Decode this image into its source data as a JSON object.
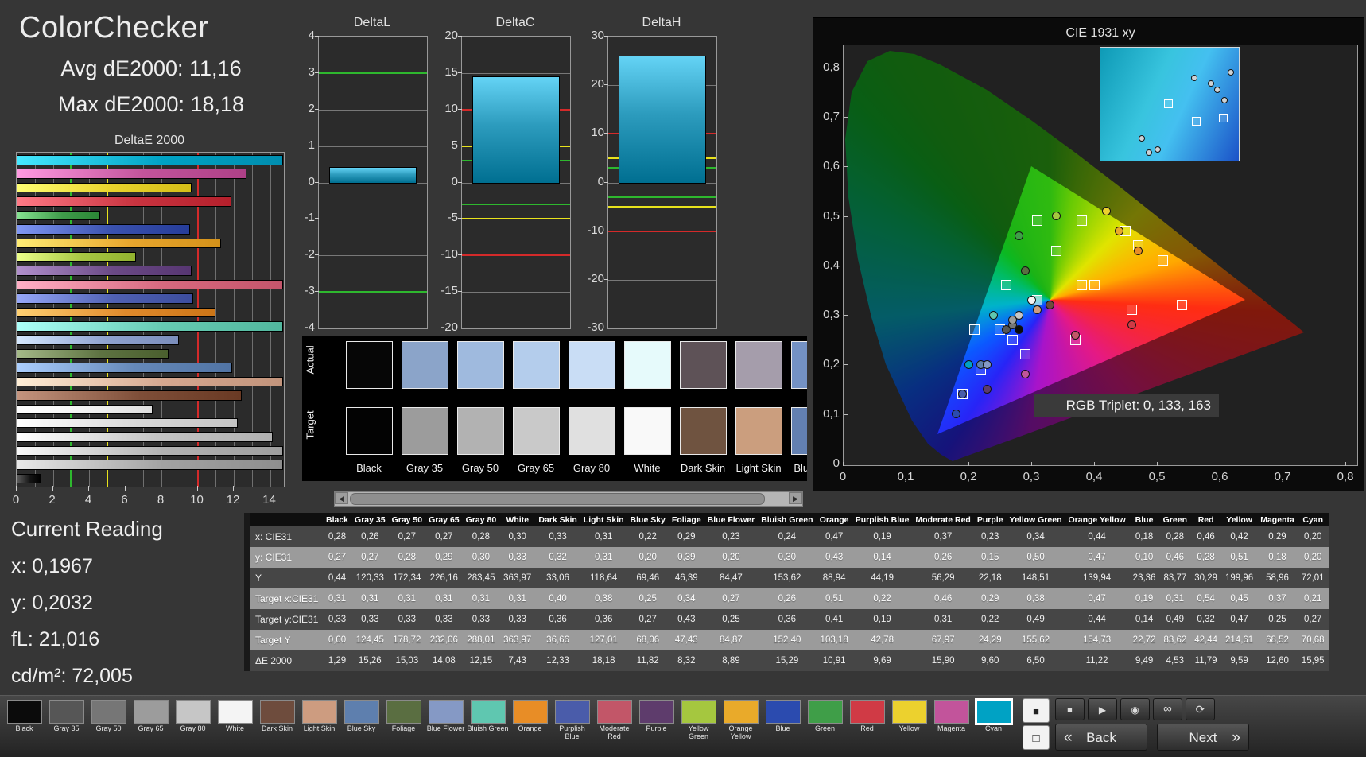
{
  "header": {
    "title": "ColorChecker",
    "avg": "Avg dE2000: 11,16",
    "max": "Max dE2000: 18,18"
  },
  "current_reading": {
    "title": "Current Reading",
    "lines": [
      "x: 0,1967",
      "y: 0,2032",
      "fL: 21,016",
      "cd/m²: 72,005"
    ]
  },
  "chart_data": [
    {
      "type": "bar",
      "title": "DeltaE 2000",
      "orientation": "horizontal",
      "xlim": [
        0,
        14.68
      ],
      "x_ticks": [
        0,
        2,
        4,
        6,
        8,
        10,
        12,
        14
      ],
      "reference_lines": [
        {
          "value": 3,
          "color": "#2eb82e"
        },
        {
          "value": 5,
          "color": "#e8e21c"
        },
        {
          "value": 10,
          "color": "#d42a2a"
        }
      ],
      "categories": [
        "Cyan",
        "Magenta",
        "Yellow",
        "Red",
        "Green",
        "Blue",
        "Orange Yellow",
        "Yellow Green",
        "Purple",
        "Moderate Red",
        "Purplish Blue",
        "Orange",
        "Bluish Green",
        "Blue Flower",
        "Foliage",
        "Blue Sky",
        "Light Skin",
        "Dark Skin",
        "White",
        "Gray 80",
        "Gray 65",
        "Gray 50",
        "Gray 35",
        "Black"
      ],
      "values": [
        15.95,
        12.6,
        9.59,
        11.79,
        4.53,
        9.49,
        11.22,
        6.5,
        9.6,
        15.9,
        9.69,
        10.91,
        15.29,
        8.89,
        8.32,
        11.82,
        18.18,
        12.33,
        7.43,
        12.15,
        14.08,
        15.03,
        15.26,
        1.29
      ],
      "colors": [
        "#00a2c4",
        "#c2549b",
        "#e8d22c",
        "#c93440",
        "#3f9b4a",
        "#3a51ae",
        "#e8a62e",
        "#a6c643",
        "#6b4a86",
        "#d8697f",
        "#5061b2",
        "#e08a2c",
        "#66cbb2",
        "#8fa2cf",
        "#5e7342",
        "#6588b8",
        "#d6a890",
        "#7e4e38",
        "#f2f2f2",
        "#d8d8d8",
        "#c4c4c4",
        "#b2b2b2",
        "#a2a2a2",
        "#141414"
      ]
    },
    {
      "type": "bar",
      "title": "DeltaL",
      "ylim": [
        -4,
        4
      ],
      "y_ticks": [
        4,
        3,
        2,
        1,
        0,
        -1,
        -2,
        -3,
        -4
      ],
      "values": [
        0.42
      ],
      "bar_color": "#2d9cbe",
      "reference_lines": [
        {
          "value": 3,
          "color": "#2eb82e"
        },
        {
          "value": -3,
          "color": "#2eb82e"
        }
      ]
    },
    {
      "type": "bar",
      "title": "DeltaC",
      "ylim": [
        -20,
        20
      ],
      "y_ticks": [
        20,
        15,
        10,
        5,
        0,
        -5,
        -10,
        -15,
        -20
      ],
      "values": [
        14.6
      ],
      "bar_color": "#2d9cbe",
      "reference_lines": [
        {
          "value": 10,
          "color": "#d42a2a"
        },
        {
          "value": 5,
          "color": "#e8e21c"
        },
        {
          "value": 3,
          "color": "#2eb82e"
        },
        {
          "value": -3,
          "color": "#2eb82e"
        },
        {
          "value": -5,
          "color": "#e8e21c"
        },
        {
          "value": -10,
          "color": "#d42a2a"
        }
      ]
    },
    {
      "type": "bar",
      "title": "DeltaH",
      "ylim": [
        -30,
        30
      ],
      "y_ticks": [
        30,
        20,
        10,
        0,
        -10,
        -20,
        -30
      ],
      "values": [
        26
      ],
      "bar_color": "#2d9cbe",
      "reference_lines": [
        {
          "value": 10,
          "color": "#d42a2a"
        },
        {
          "value": 5,
          "color": "#e8e21c"
        },
        {
          "value": 3,
          "color": "#2eb82e"
        },
        {
          "value": -3,
          "color": "#2eb82e"
        },
        {
          "value": -5,
          "color": "#e8e21c"
        },
        {
          "value": -10,
          "color": "#d42a2a"
        }
      ]
    },
    {
      "type": "scatter",
      "title": "CIE 1931 xy",
      "annotation": "RGB Triplet: 0, 133, 163",
      "x_ticks": [
        "0",
        "0,1",
        "0,2",
        "0,3",
        "0,4",
        "0,5",
        "0,6",
        "0,7",
        "0,8"
      ],
      "y_ticks": [
        "0,8",
        "0,7",
        "0,6",
        "0,5",
        "0,4",
        "0,3",
        "0,2",
        "0,1",
        "0"
      ],
      "gamut_triangle": [
        [
          0.64,
          0.33
        ],
        [
          0.3,
          0.6
        ],
        [
          0.15,
          0.06
        ]
      ],
      "targets": [
        [
          0.31,
          0.33
        ],
        [
          0.31,
          0.33
        ],
        [
          0.31,
          0.33
        ],
        [
          0.31,
          0.33
        ],
        [
          0.31,
          0.33
        ],
        [
          0.31,
          0.33
        ],
        [
          0.4,
          0.36
        ],
        [
          0.38,
          0.36
        ],
        [
          0.25,
          0.27
        ],
        [
          0.34,
          0.43
        ],
        [
          0.27,
          0.25
        ],
        [
          0.26,
          0.36
        ],
        [
          0.51,
          0.41
        ],
        [
          0.22,
          0.19
        ],
        [
          0.46,
          0.31
        ],
        [
          0.29,
          0.22
        ],
        [
          0.38,
          0.49
        ],
        [
          0.47,
          0.44
        ],
        [
          0.19,
          0.14
        ],
        [
          0.31,
          0.49
        ],
        [
          0.54,
          0.32
        ],
        [
          0.45,
          0.47
        ],
        [
          0.37,
          0.25
        ],
        [
          0.21,
          0.27
        ]
      ],
      "measured": [
        [
          0.28,
          0.27
        ],
        [
          0.26,
          0.27
        ],
        [
          0.27,
          0.28
        ],
        [
          0.27,
          0.29
        ],
        [
          0.28,
          0.3
        ],
        [
          0.3,
          0.33
        ],
        [
          0.33,
          0.32
        ],
        [
          0.31,
          0.31
        ],
        [
          0.22,
          0.2
        ],
        [
          0.29,
          0.39
        ],
        [
          0.23,
          0.2
        ],
        [
          0.24,
          0.3
        ],
        [
          0.47,
          0.43
        ],
        [
          0.19,
          0.14
        ],
        [
          0.37,
          0.26
        ],
        [
          0.23,
          0.15
        ],
        [
          0.34,
          0.5
        ],
        [
          0.44,
          0.47
        ],
        [
          0.18,
          0.1
        ],
        [
          0.28,
          0.46
        ],
        [
          0.46,
          0.28
        ],
        [
          0.42,
          0.51
        ],
        [
          0.29,
          0.18
        ],
        [
          0.2,
          0.2
        ]
      ],
      "inset": {
        "squares": [
          [
            85,
            70
          ],
          [
            154,
            88
          ],
          [
            120,
            92
          ]
        ],
        "circles": [
          [
            118,
            38
          ],
          [
            139,
            45
          ],
          [
            147,
            53
          ],
          [
            156,
            66
          ],
          [
            164,
            31
          ],
          [
            72,
            128
          ],
          [
            52,
            114
          ],
          [
            61,
            132
          ]
        ]
      }
    }
  ],
  "swatch_panel": {
    "row_labels": [
      "Actual",
      "Target"
    ],
    "columns": [
      {
        "label": "Black",
        "actual": "#060606",
        "target": "#030303"
      },
      {
        "label": "Gray 35",
        "actual": "#8ba4c9",
        "target": "#9c9c9c"
      },
      {
        "label": "Gray 50",
        "actual": "#9fbade",
        "target": "#b2b2b2"
      },
      {
        "label": "Gray 65",
        "actual": "#b4cdec",
        "target": "#c9c9c9"
      },
      {
        "label": "Gray 80",
        "actual": "#c9ddf5",
        "target": "#e0e0e0"
      },
      {
        "label": "White",
        "actual": "#e6fafb",
        "target": "#f9f9f9"
      },
      {
        "label": "Dark Skin",
        "actual": "#5e5257",
        "target": "#6f5340"
      },
      {
        "label": "Light Skin",
        "actual": "#a59dab",
        "target": "#cb9e7e"
      },
      {
        "label": "Blue Sky",
        "actual": "#7492c4",
        "target": "#6380b1"
      }
    ],
    "scroll_left": "◀",
    "scroll_right": "▶"
  },
  "table": {
    "columns": [
      "Black",
      "Gray 35",
      "Gray 50",
      "Gray 65",
      "Gray 80",
      "White",
      "Dark Skin",
      "Light Skin",
      "Blue Sky",
      "Foliage",
      "Blue Flower",
      "Bluish Green",
      "Orange",
      "Purplish Blue",
      "Moderate Red",
      "Purple",
      "Yellow Green",
      "Orange Yellow",
      "Blue",
      "Green",
      "Red",
      "Yellow",
      "Magenta",
      "Cyan"
    ],
    "row_labels": [
      "x: CIE31",
      "y: CIE31",
      "Y",
      "Target x:CIE31",
      "Target y:CIE31",
      "Target Y",
      "ΔE 2000"
    ],
    "rows": [
      [
        "0,28",
        "0,26",
        "0,27",
        "0,27",
        "0,28",
        "0,30",
        "0,33",
        "0,31",
        "0,22",
        "0,29",
        "0,23",
        "0,24",
        "0,47",
        "0,19",
        "0,37",
        "0,23",
        "0,34",
        "0,44",
        "0,18",
        "0,28",
        "0,46",
        "0,42",
        "0,29",
        "0,20"
      ],
      [
        "0,27",
        "0,27",
        "0,28",
        "0,29",
        "0,30",
        "0,33",
        "0,32",
        "0,31",
        "0,20",
        "0,39",
        "0,20",
        "0,30",
        "0,43",
        "0,14",
        "0,26",
        "0,15",
        "0,50",
        "0,47",
        "0,10",
        "0,46",
        "0,28",
        "0,51",
        "0,18",
        "0,20"
      ],
      [
        "0,44",
        "120,33",
        "172,34",
        "226,16",
        "283,45",
        "363,97",
        "33,06",
        "118,64",
        "69,46",
        "46,39",
        "84,47",
        "153,62",
        "88,94",
        "44,19",
        "56,29",
        "22,18",
        "148,51",
        "139,94",
        "23,36",
        "83,77",
        "30,29",
        "199,96",
        "58,96",
        "72,01"
      ],
      [
        "0,31",
        "0,31",
        "0,31",
        "0,31",
        "0,31",
        "0,31",
        "0,40",
        "0,38",
        "0,25",
        "0,34",
        "0,27",
        "0,26",
        "0,51",
        "0,22",
        "0,46",
        "0,29",
        "0,38",
        "0,47",
        "0,19",
        "0,31",
        "0,54",
        "0,45",
        "0,37",
        "0,21"
      ],
      [
        "0,33",
        "0,33",
        "0,33",
        "0,33",
        "0,33",
        "0,33",
        "0,36",
        "0,36",
        "0,27",
        "0,43",
        "0,25",
        "0,36",
        "0,41",
        "0,19",
        "0,31",
        "0,22",
        "0,49",
        "0,44",
        "0,14",
        "0,49",
        "0,32",
        "0,47",
        "0,25",
        "0,27"
      ],
      [
        "0,00",
        "124,45",
        "178,72",
        "232,06",
        "288,01",
        "363,97",
        "36,66",
        "127,01",
        "68,06",
        "47,43",
        "84,87",
        "152,40",
        "103,18",
        "42,78",
        "67,97",
        "24,29",
        "155,62",
        "154,73",
        "22,72",
        "83,62",
        "42,44",
        "214,61",
        "68,52",
        "70,68"
      ],
      [
        "1,29",
        "15,26",
        "15,03",
        "14,08",
        "12,15",
        "7,43",
        "12,33",
        "18,18",
        "11,82",
        "8,32",
        "8,89",
        "15,29",
        "10,91",
        "9,69",
        "15,90",
        "9,60",
        "6,50",
        "11,22",
        "9,49",
        "4,53",
        "11,79",
        "9,59",
        "12,60",
        "15,95"
      ]
    ]
  },
  "toolbar": {
    "patches": [
      {
        "label": "Black",
        "color": "#0b0b0b"
      },
      {
        "label": "Gray 35",
        "color": "#565656"
      },
      {
        "label": "Gray 50",
        "color": "#767676"
      },
      {
        "label": "Gray 65",
        "color": "#9c9c9c"
      },
      {
        "label": "Gray 80",
        "color": "#c6c6c6"
      },
      {
        "label": "White",
        "color": "#f4f4f4"
      },
      {
        "label": "Dark Skin",
        "color": "#6e4c3d"
      },
      {
        "label": "Light Skin",
        "color": "#cd9c80"
      },
      {
        "label": "Blue Sky",
        "color": "#5e7fae"
      },
      {
        "label": "Foliage",
        "color": "#5a6e41"
      },
      {
        "label": "Blue Flower",
        "color": "#8599c5"
      },
      {
        "label": "Bluish Green",
        "color": "#5fc7b0"
      },
      {
        "label": "Orange",
        "color": "#e88d26"
      },
      {
        "label": "Purplish Blue",
        "color": "#4a5caa"
      },
      {
        "label": "Moderate Red",
        "color": "#c25668"
      },
      {
        "label": "Purple",
        "color": "#5e3c6c"
      },
      {
        "label": "Yellow Green",
        "color": "#a5c73f"
      },
      {
        "label": "Orange Yellow",
        "color": "#e9aa2a"
      },
      {
        "label": "Blue",
        "color": "#2b4baf"
      },
      {
        "label": "Green",
        "color": "#3f9e48"
      },
      {
        "label": "Red",
        "color": "#d03a45"
      },
      {
        "label": "Yellow",
        "color": "#ecd12e"
      },
      {
        "label": "Magenta",
        "color": "#c2549b"
      },
      {
        "label": "Cyan",
        "color": "#00a2c4"
      }
    ],
    "selected_patch": "Cyan",
    "back_label": "Back",
    "next_label": "Next",
    "back_chevron": "«",
    "next_chevron": "»",
    "icons": {
      "stop": "■",
      "play": "▶",
      "measure": "◉",
      "loop": "∞",
      "refresh": "⟳",
      "window": "■",
      "pattern": "□"
    }
  }
}
